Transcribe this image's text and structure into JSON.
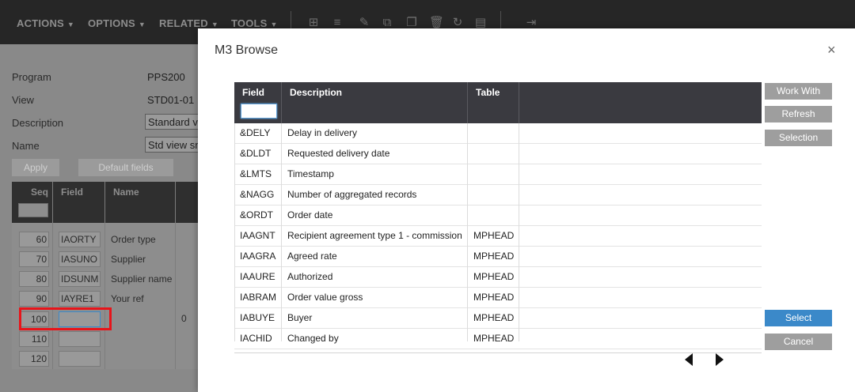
{
  "toolbar": {
    "menus": [
      "ACTIONS",
      "OPTIONS",
      "RELATED",
      "TOOLS"
    ],
    "icons": [
      "add-icon",
      "list-icon",
      "edit-icon",
      "copy-icon",
      "copy-alt-icon",
      "delete-icon",
      "refresh-icon",
      "display-icon",
      "export-icon"
    ]
  },
  "background_form": {
    "fields": [
      {
        "label": "Program",
        "value": "PPS200"
      },
      {
        "label": "View",
        "value": "STD01-01"
      },
      {
        "label": "Description",
        "value": "Standard v"
      },
      {
        "label": "Name",
        "value": "Std view sm"
      }
    ],
    "buttons": {
      "apply": "Apply",
      "default_fields": "Default fields"
    },
    "grid": {
      "headers": {
        "seq": "Seq",
        "field": "Field",
        "name": "Name"
      },
      "rows": [
        {
          "seq": "60",
          "field": "IAORTY",
          "name": "Order type"
        },
        {
          "seq": "70",
          "field": "IASUNO",
          "name": "Supplier"
        },
        {
          "seq": "80",
          "field": "IDSUNM",
          "name": "Supplier name"
        },
        {
          "seq": "90",
          "field": "IAYRE1",
          "name": "Your ref"
        },
        {
          "seq": "100",
          "field": "",
          "name": ""
        },
        {
          "seq": "110",
          "field": "",
          "name": ""
        },
        {
          "seq": "120",
          "field": "",
          "name": ""
        }
      ],
      "extra_value": "0"
    }
  },
  "modal": {
    "title": "M3 Browse",
    "close_symbol": "×",
    "columns": {
      "field": "Field",
      "description": "Description",
      "table": "Table"
    },
    "filter_value": "",
    "rows": [
      {
        "field": "&DELY",
        "description": "Delay in delivery",
        "table": ""
      },
      {
        "field": "&DLDT",
        "description": "Requested delivery date",
        "table": ""
      },
      {
        "field": "&LMTS",
        "description": "Timestamp",
        "table": ""
      },
      {
        "field": "&NAGG",
        "description": "Number of aggregated records",
        "table": ""
      },
      {
        "field": "&ORDT",
        "description": "Order date",
        "table": ""
      },
      {
        "field": "IAAGNT",
        "description": "Recipient agreement type 1 - commission",
        "table": "MPHEAD"
      },
      {
        "field": "IAAGRA",
        "description": "Agreed rate",
        "table": "MPHEAD"
      },
      {
        "field": "IAAURE",
        "description": "Authorized",
        "table": "MPHEAD"
      },
      {
        "field": "IABRAM",
        "description": "Order value gross",
        "table": "MPHEAD"
      },
      {
        "field": "IABUYE",
        "description": "Buyer",
        "table": "MPHEAD"
      },
      {
        "field": "IACHID",
        "description": "Changed by",
        "table": "MPHEAD"
      }
    ],
    "buttons": {
      "work_with": "Work With",
      "refresh": "Refresh",
      "selection": "Selection",
      "select": "Select",
      "cancel": "Cancel"
    },
    "colors": {
      "header_bg": "#3a3a40",
      "primary_button": "#3b89c9",
      "secondary_button": "#9e9e9e",
      "highlight_red": "#e8141a"
    }
  }
}
